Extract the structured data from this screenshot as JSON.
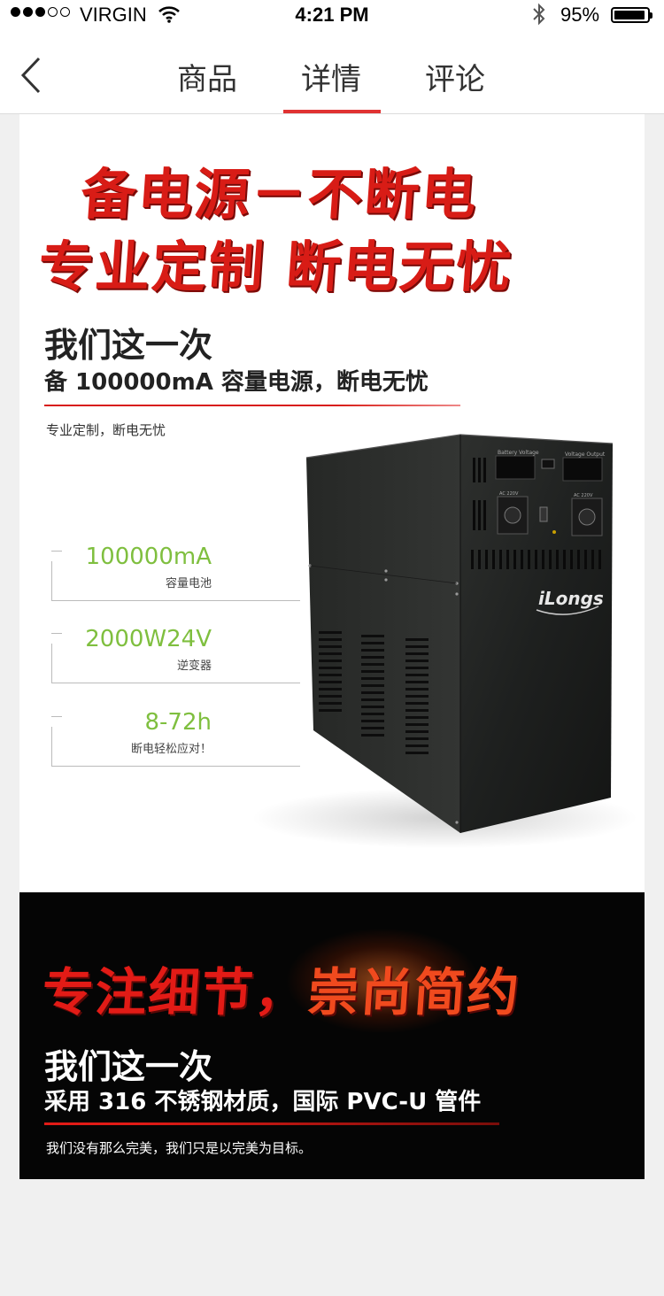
{
  "status_bar": {
    "carrier": "VIRGIN",
    "time": "4:21 PM",
    "battery": "95%",
    "battery_level": 0.95
  },
  "nav": {
    "tabs": [
      "商品",
      "详情",
      "评论"
    ],
    "active_tab": "详情"
  },
  "detail_1": {
    "headline_1": "备电源－不断电",
    "headline_2": "专业定制 断电无忧",
    "title": "我们这一次",
    "subtitle": "备 100000mA 容量电源，断电无忧",
    "note": "专业定制，断电无忧",
    "specs": [
      {
        "value": "100000mA",
        "label": "容量电池"
      },
      {
        "value": "2000W24V",
        "label": "逆变器"
      },
      {
        "value": "8-72h",
        "label": "断电轻松应对！"
      }
    ],
    "product": {
      "brand": "iLongs",
      "display_left": "Battery Voltage",
      "display_right": "Voltage Output",
      "socket_label": "AC 220V"
    }
  },
  "detail_2": {
    "headline_a": "专注细节，",
    "headline_b": "崇尚简约",
    "title": "我们这一次",
    "subtitle": "采用 316 不锈钢材质，国际 PVC-U 管件",
    "note": "我们没有那么完美，我们只是以完美为目标。"
  },
  "colors": {
    "accent": "#e03232",
    "headline_red": "#d81c16",
    "spec_green": "#7fbf3f"
  }
}
